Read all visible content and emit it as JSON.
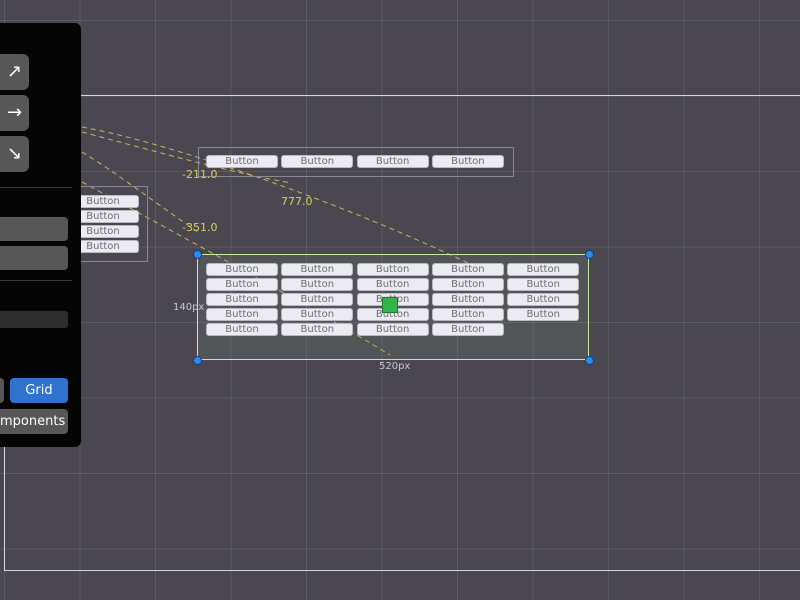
{
  "canvas": {
    "button_label": "Button",
    "row_group": {
      "buttons": [
        "Button",
        "Button",
        "Button",
        "Button"
      ]
    },
    "column_group": {
      "buttons": [
        "Button",
        "Button",
        "Button",
        "Button"
      ]
    },
    "grid_group": {
      "buttons": [
        "Button",
        "Button",
        "Button",
        "Button",
        "Button",
        "Button",
        "Button",
        "Button",
        "Button",
        "Button",
        "Button",
        "Button",
        "Button",
        "Button",
        "Button",
        "Button",
        "Button",
        "Button",
        "Button",
        "Button",
        "Button",
        "Button",
        "Button",
        "Button"
      ],
      "width_label": "520px",
      "height_label": "140px"
    },
    "distance_labels": [
      "-211.0",
      "777.0",
      "-351.0"
    ],
    "colors": {
      "background": "#4a4751",
      "selection": "#c7e8a0",
      "handle": "#2f8ae6",
      "guide": "#d9cd5c"
    }
  },
  "panel": {
    "arrow_icons": [
      "arrow-up-right-icon",
      "arrow-right-icon",
      "arrow-down-right-icon"
    ],
    "arrow_glyphs": [
      "↗",
      "→",
      "↘"
    ],
    "grid_button": "Grid",
    "components_button": "mponents",
    "accent_color": "#3172d0"
  }
}
